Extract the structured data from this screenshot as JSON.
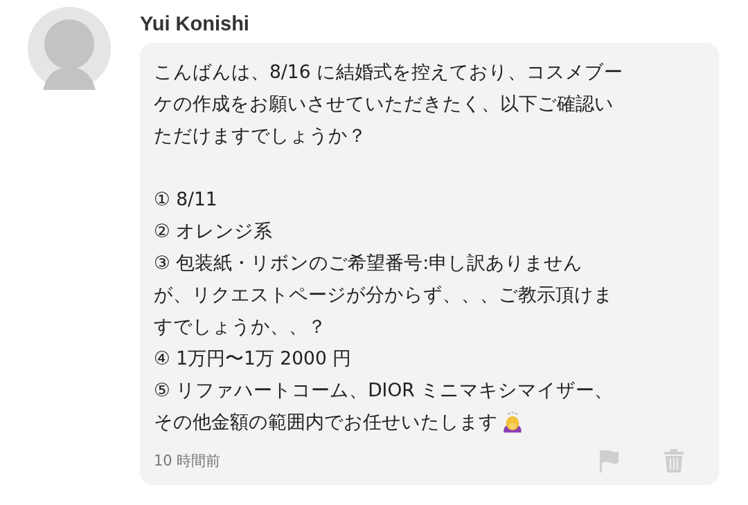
{
  "message": {
    "sender": "Yui Konishi",
    "paragraphs": [
      [
        "こんばんは、8/16 に結婚式を控えており、コスメブー",
        "ケの作成をお願いさせていただきたく、以下ご確認い",
        "ただけますでしょうか？"
      ],
      [
        "① 8/11",
        "② オレンジ系",
        "③ 包装紙・リボンのご希望番号:申し訳ありません",
        "が、リクエストページが分からず、、、ご教示頂けま",
        "すでしょうか、、？",
        "④ 1万円〜1万 2000 円",
        "⑤ リファハートコーム、DIOR ミニマキシマイザー、",
        "その他金額の範囲内でお任せいたします"
      ]
    ],
    "time": "10 時間前"
  }
}
